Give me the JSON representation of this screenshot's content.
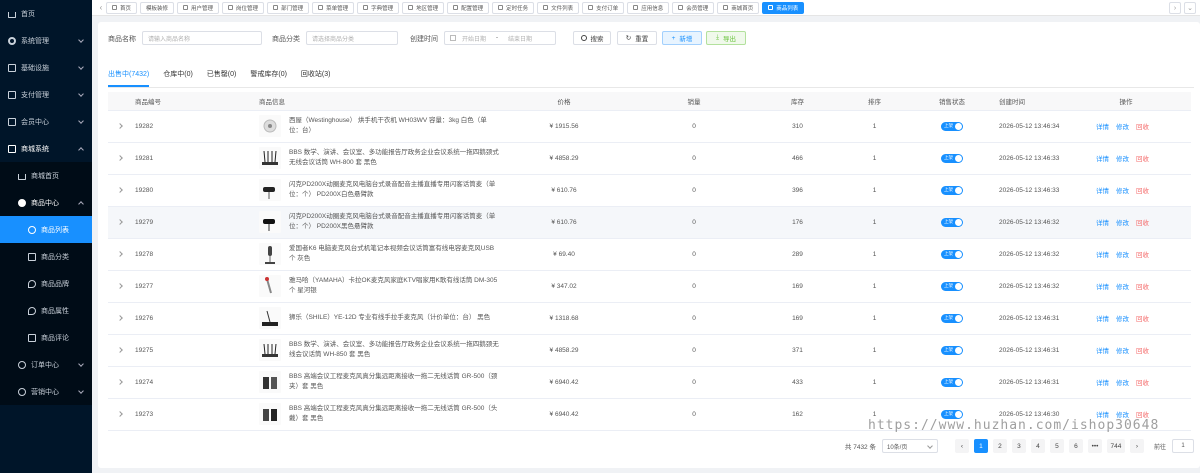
{
  "sidebar": {
    "items": [
      {
        "label": "首页",
        "icon": "home-icon"
      },
      {
        "label": "系统管理",
        "icon": "gear-icon"
      },
      {
        "label": "基础设施",
        "icon": "monitor-icon"
      },
      {
        "label": "支付管理",
        "icon": "wallet-icon"
      },
      {
        "label": "会员中心",
        "icon": "user-icon"
      },
      {
        "label": "商城系统",
        "icon": "shop-icon"
      },
      {
        "label": "商城首页",
        "icon": "home-icon"
      },
      {
        "label": "商品中心",
        "icon": "product-icon"
      },
      {
        "label": "商品列表",
        "icon": "list-icon"
      },
      {
        "label": "商品分类",
        "icon": "category-icon"
      },
      {
        "label": "商品品牌",
        "icon": "brand-icon"
      },
      {
        "label": "商品属性",
        "icon": "attribute-icon"
      },
      {
        "label": "商品评论",
        "icon": "comment-icon"
      },
      {
        "label": "订单中心",
        "icon": "order-icon"
      },
      {
        "label": "营销中心",
        "icon": "marketing-icon"
      }
    ]
  },
  "tabs": [
    "首页",
    "模板装修",
    "用户管理",
    "岗位管理",
    "部门管理",
    "菜单管理",
    "字典管理",
    "地区管理",
    "配置管理",
    "定时任务",
    "文件列表",
    "支付订单",
    "应用信息",
    "会员管理",
    "商城首页",
    "商品列表"
  ],
  "search": {
    "name_label": "商品名称",
    "name_placeholder": "请输入商品名称",
    "category_label": "商品分类",
    "category_placeholder": "请选择商品分类",
    "time_label": "创建时间",
    "start_placeholder": "开始日期",
    "range_sep": "-",
    "end_placeholder": "结束日期",
    "search_btn": "搜索",
    "reset_btn": "重置",
    "add_btn": "新增",
    "export_btn": "导出"
  },
  "status_tabs": [
    "出售中(7432)",
    "仓库中(0)",
    "已售罄(0)",
    "警戒库存(0)",
    "回收站(3)"
  ],
  "table": {
    "headers": [
      "商品编号",
      "商品信息",
      "价格",
      "销量",
      "库存",
      "排序",
      "销售状态",
      "创建时间",
      "操作"
    ],
    "switch_label": "上架",
    "actions": [
      "详情",
      "修改",
      "回收"
    ],
    "rows": [
      {
        "id": "19282",
        "name": "西屋（Westinghouse） 烘手机干衣机 WH03WV 容量：3kg 白色（单位：台）",
        "price": "¥ 1915.56",
        "sales": "0",
        "stock": "310",
        "sort": "1",
        "created": "2026-05-12 13:46:34"
      },
      {
        "id": "19281",
        "name": "BBS 数学、演讲、会议室、多功能报告厅政务企业会议系统一拖四鹅颈式无线会议话筒 WH-800 套 黑色",
        "price": "¥ 4858.29",
        "sales": "0",
        "stock": "466",
        "sort": "1",
        "created": "2026-05-12 13:46:33"
      },
      {
        "id": "19280",
        "name": "闪克PD200X动圈麦克风电脑台式录音配音主播直播专用闪客话筒麦（单位：个） PD200X白色悬臂款",
        "price": "¥ 610.76",
        "sales": "0",
        "stock": "396",
        "sort": "1",
        "created": "2026-05-12 13:46:33"
      },
      {
        "id": "19279",
        "name": "闪克PD200X动圈麦克风电脑台式录音配音主播直播专用闪客话筒麦（单位：个） PD200X黑色悬臂款",
        "price": "¥ 610.76",
        "sales": "0",
        "stock": "176",
        "sort": "1",
        "created": "2026-05-12 13:46:32"
      },
      {
        "id": "19278",
        "name": "爱国者K6 电脑麦克风台式机笔记本视频会议话筒富有线电容麦克风USB 个 灰色",
        "price": "¥ 69.40",
        "sales": "0",
        "stock": "289",
        "sort": "1",
        "created": "2026-05-12 13:46:32"
      },
      {
        "id": "19277",
        "name": "雅马哈（YAMAHA）卡拉OK麦克风家庭KTV唱家用K歌有线话筒 DM-305 个 星河银",
        "price": "¥ 347.02",
        "sales": "0",
        "stock": "169",
        "sort": "1",
        "created": "2026-05-12 13:46:32"
      },
      {
        "id": "19276",
        "name": "狮乐（SHILE）YE-12D 专业有线手拉手麦克风（计价单位：台） 黑色",
        "price": "¥ 1318.68",
        "sales": "0",
        "stock": "169",
        "sort": "1",
        "created": "2026-05-12 13:46:31"
      },
      {
        "id": "19275",
        "name": "BBS 数学、演讲、会议室、多功能报告厅政务企业会议系统一拖四鹅颈无线会议话筒 WH-850 套 黑色",
        "price": "¥ 4858.29",
        "sales": "0",
        "stock": "371",
        "sort": "1",
        "created": "2026-05-12 13:46:31"
      },
      {
        "id": "19274",
        "name": "BBS 高端会议工程麦克风真分集远距离接收一拖二无线话筒 GR-500（颈夹）套 黑色",
        "price": "¥ 6940.42",
        "sales": "0",
        "stock": "433",
        "sort": "1",
        "created": "2026-05-12 13:46:31"
      },
      {
        "id": "19273",
        "name": "BBS 高端会议工程麦克风真分集远距离接收一拖二无线话筒 GR-500（头戴）套 黑色",
        "price": "¥ 6940.42",
        "sales": "0",
        "stock": "162",
        "sort": "1",
        "created": "2026-05-12 13:46:30"
      }
    ]
  },
  "pagination": {
    "total": "共 7432 条",
    "page_size": "10条/页",
    "pages": [
      "1",
      "2",
      "3",
      "4",
      "5",
      "6",
      "•••",
      "744"
    ],
    "goto_label": "前往",
    "goto_value": "1"
  },
  "watermark": "https://www.huzhan.com/ishop30648"
}
